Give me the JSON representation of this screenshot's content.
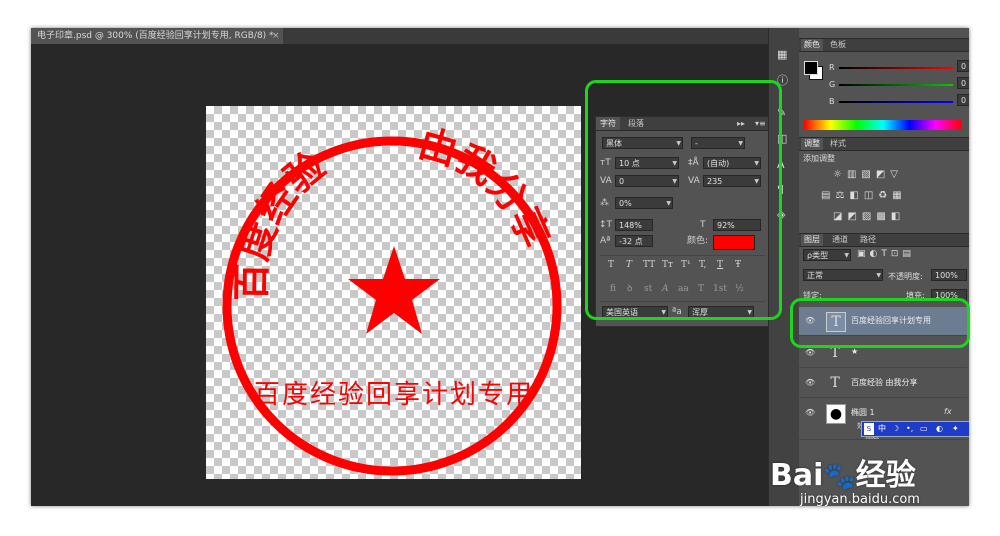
{
  "document_tab": {
    "title": "电子印章.psd @ 300% (百度经验回享计划专用, RGB/8) *",
    "close": "×"
  },
  "seal": {
    "arc_left_text": "百度经验",
    "arc_right_text": "由我分享",
    "bottom_text": "百度经验回享计划专用",
    "color": "#ff0000"
  },
  "character_panel": {
    "tabs": [
      "字符",
      "段落"
    ],
    "menu_glyphs": [
      "▸▸",
      "▾≡"
    ],
    "font_family": "黑体",
    "font_style": "-",
    "font_size": "10 点",
    "leading": "(自动)",
    "kerning": "0",
    "tracking": "235",
    "scale_label": "0%",
    "vertical_scale": "148%",
    "horizontal_scale": "92%",
    "baseline_shift": "-32 点",
    "color_label": "颜色:",
    "color_value": "#ff0000",
    "style_buttons": [
      "T",
      "T",
      "TT",
      "Tт",
      "T¹",
      "T,",
      "T",
      "Ŧ"
    ],
    "opentype_buttons": [
      "fi",
      "ꝺ",
      "st",
      "A",
      "aa",
      "T",
      "1st",
      "½"
    ],
    "language": "美国英语",
    "aa_label": "ªa",
    "antialias": "浑厚"
  },
  "color_panel": {
    "tabs": [
      "颜色",
      "色板"
    ],
    "channels": [
      {
        "label": "R",
        "value": "0",
        "color": "#ff0000"
      },
      {
        "label": "G",
        "value": "0",
        "color": "#00cc00"
      },
      {
        "label": "B",
        "value": "0",
        "color": "#0000ff"
      }
    ]
  },
  "adjust_panel": {
    "tabs": [
      "调整",
      "样式"
    ],
    "title": "添加调整"
  },
  "layers_panel": {
    "tabs": [
      "图层",
      "通道",
      "路径"
    ],
    "filter_label": "ρ类型",
    "blend_mode": "正常",
    "opacity_label": "不透明度:",
    "opacity": "100%",
    "lock_label": "锁定:",
    "fill_label": "填充:",
    "fill": "100%",
    "layers": [
      {
        "name": "百度经验回享计划专用",
        "thumb": "T",
        "selected": true
      },
      {
        "name": "★",
        "thumb": "T",
        "selected": false
      },
      {
        "name": "百度经验  由我分享",
        "thumb": "T",
        "selected": false
      },
      {
        "name": "椭圆 1",
        "thumb": "●",
        "selected": false
      }
    ],
    "fx": "fx",
    "effects_label": "效",
    "stroke_label": "描边"
  },
  "ime_bar": {
    "items": [
      "中",
      "☽",
      "•,",
      "▭",
      "◐",
      "✦"
    ]
  },
  "watermark": {
    "brand": "Bai",
    "brand_suffix": "经验",
    "url": "jingyan.baidu.com"
  }
}
